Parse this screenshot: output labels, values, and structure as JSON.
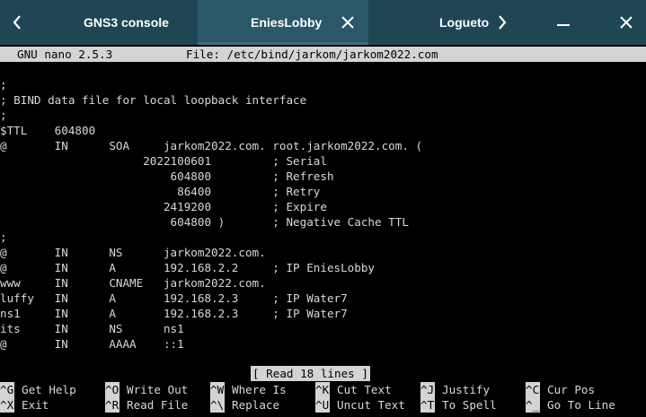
{
  "window": {
    "tabs": [
      {
        "label": "GNS3 console"
      },
      {
        "label": "EniesLobby"
      },
      {
        "label": "Loguetow"
      }
    ],
    "colors": {
      "titlebar": "#1f4655",
      "active_tab": "#2b5868"
    }
  },
  "nano": {
    "version": "GNU nano 2.5.3",
    "file": "File: /etc/bind/jarkom/jarkom2022.com"
  },
  "editor": {
    "lines": [
      ";",
      "; BIND data file for local loopback interface",
      ";",
      "$TTL    604800",
      "@       IN      SOA     jarkom2022.com. root.jarkom2022.com. (",
      "                     2022100601         ; Serial",
      "                         604800         ; Refresh",
      "                          86400         ; Retry",
      "                        2419200         ; Expire",
      "                         604800 )       ; Negative Cache TTL",
      ";",
      "@       IN      NS      jarkom2022.com.",
      "@       IN      A       192.168.2.2     ; IP EniesLobby",
      "www     IN      CNAME   jarkom2022.com.",
      "luffy   IN      A       192.168.2.3     ; IP Water7",
      "ns1     IN      A       192.168.2.3     ; IP Water7",
      "its     IN      NS      ns1",
      "@       IN      AAAA    ::1"
    ]
  },
  "status": "[ Read 18 lines ]",
  "shortcuts": [
    {
      "key": "^G",
      "label": "Get Help"
    },
    {
      "key": "^O",
      "label": "Write Out"
    },
    {
      "key": "^W",
      "label": "Where Is"
    },
    {
      "key": "^K",
      "label": "Cut Text"
    },
    {
      "key": "^J",
      "label": "Justify"
    },
    {
      "key": "^C",
      "label": "Cur Pos"
    },
    {
      "key": "^X",
      "label": "Exit"
    },
    {
      "key": "^R",
      "label": "Read File"
    },
    {
      "key": "^\\",
      "label": "Replace"
    },
    {
      "key": "^U",
      "label": "Uncut Text"
    },
    {
      "key": "^T",
      "label": "To Spell"
    },
    {
      "key": "^_",
      "label": "Go To Line"
    }
  ]
}
